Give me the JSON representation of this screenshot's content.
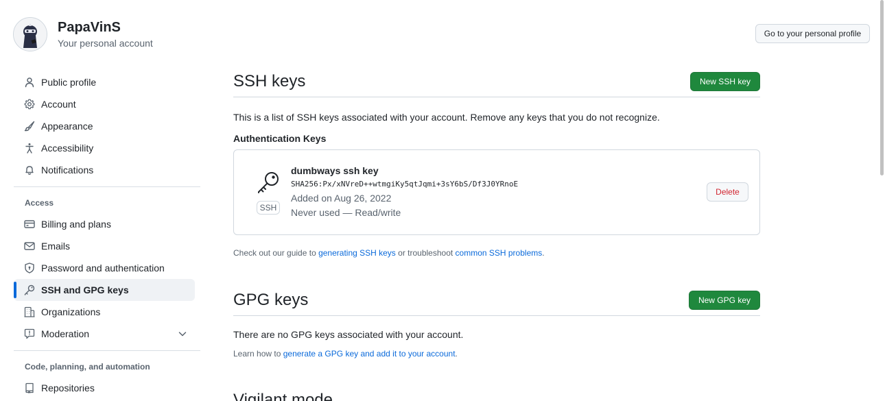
{
  "header": {
    "account_name": "PapaVinS",
    "account_sub": "Your personal account",
    "profile_button": "Go to your personal profile"
  },
  "sidebar": {
    "items": [
      {
        "label": "Public profile",
        "icon": "person-icon"
      },
      {
        "label": "Account",
        "icon": "gear-icon"
      },
      {
        "label": "Appearance",
        "icon": "paintbrush-icon"
      },
      {
        "label": "Accessibility",
        "icon": "accessibility-icon"
      },
      {
        "label": "Notifications",
        "icon": "bell-icon"
      }
    ],
    "access_title": "Access",
    "access_items": [
      {
        "label": "Billing and plans",
        "icon": "credit-card-icon"
      },
      {
        "label": "Emails",
        "icon": "mail-icon"
      },
      {
        "label": "Password and authentication",
        "icon": "shield-lock-icon"
      },
      {
        "label": "SSH and GPG keys",
        "icon": "key-icon",
        "active": true
      },
      {
        "label": "Organizations",
        "icon": "organization-icon"
      },
      {
        "label": "Moderation",
        "icon": "report-icon"
      }
    ],
    "code_title": "Code, planning, and automation",
    "code_items": [
      {
        "label": "Repositories",
        "icon": "repo-icon"
      }
    ]
  },
  "ssh": {
    "title": "SSH keys",
    "new_button": "New SSH key",
    "description": "This is a list of SSH keys associated with your account. Remove any keys that you do not recognize.",
    "auth_heading": "Authentication Keys",
    "key": {
      "title": "dumbways ssh key",
      "fingerprint": "SHA256:Px/xNVreD++wtmgiKy5qtJqmi+3sY6bS/Df3J0YRnoE",
      "added": "Added on Aug 26, 2022",
      "usage": "Never used — Read/write",
      "badge": "SSH",
      "delete_label": "Delete"
    },
    "guide_prefix": "Check out our guide to ",
    "guide_link1": "generating SSH keys",
    "guide_middle": " or troubleshoot ",
    "guide_link2": "common SSH problems",
    "guide_suffix": "."
  },
  "gpg": {
    "title": "GPG keys",
    "new_button": "New GPG key",
    "description": "There are no GPG keys associated with your account.",
    "learn_prefix": "Learn how to ",
    "learn_link": "generate a GPG key and add it to your account",
    "learn_suffix": "."
  },
  "vigilant": {
    "title": "Vigilant mode"
  }
}
